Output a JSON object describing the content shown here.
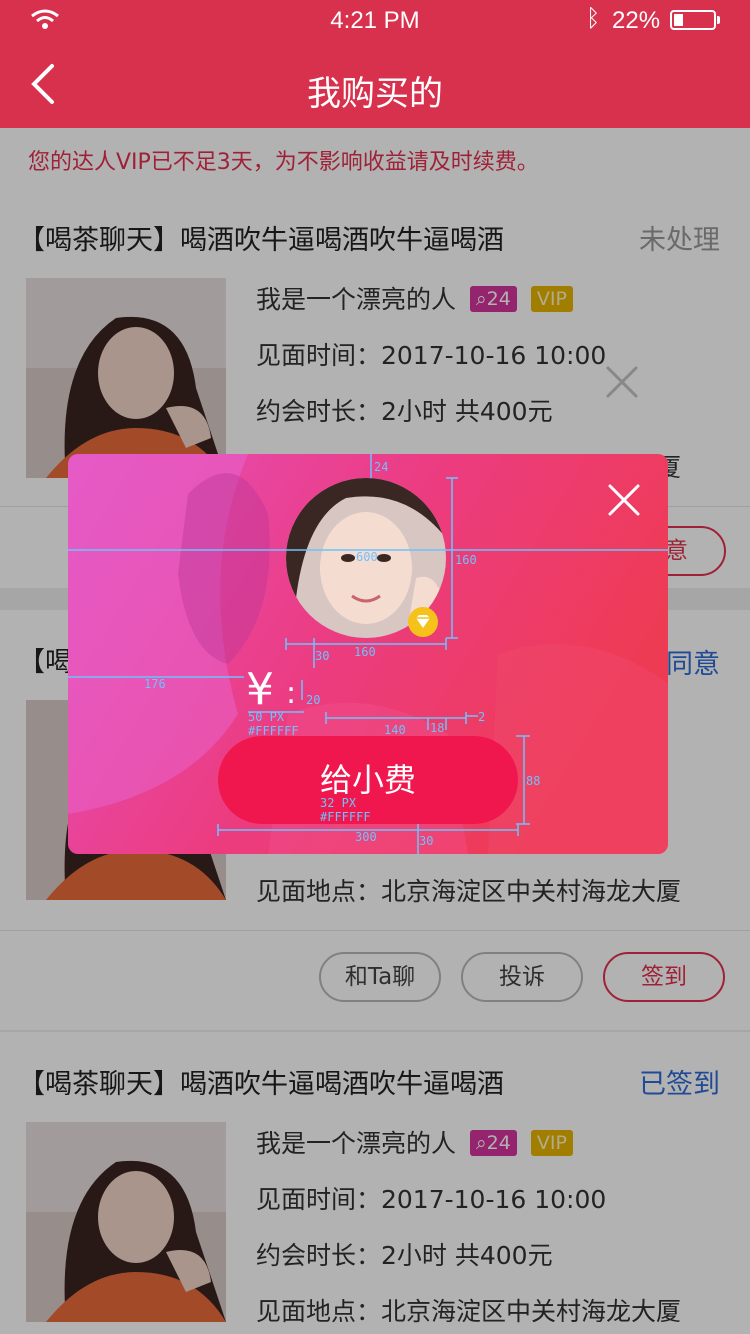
{
  "status_bar": {
    "time": "4:21 PM",
    "battery_pct": "22%",
    "icons": [
      "wifi-icon",
      "bluetooth-icon",
      "battery-icon"
    ]
  },
  "nav": {
    "title": "我购买的",
    "back_icon": "chevron-left-icon"
  },
  "notice": "您的达人VIP已不足3天，为不影响收益请及时续费。",
  "orders": [
    {
      "title": "【喝茶聊天】喝酒吹牛逼喝酒吹牛逼喝酒",
      "status": "未处理",
      "name": "我是一个漂亮的人",
      "badge_count": "24",
      "vip": "VIP",
      "time": "见面时间：2017-10-16  10:00",
      "duration": "约会时长：2小时  共400元",
      "place": "见面地点：北京海淀区中关村海龙大厦",
      "action": "意"
    },
    {
      "title": "【喝",
      "status": "同意",
      "place": "见面地点：北京海淀区中关村海龙大厦",
      "buttons": [
        "和Ta聊",
        "投诉",
        "签到"
      ]
    },
    {
      "title": "【喝茶聊天】喝酒吹牛逼喝酒吹牛逼喝酒",
      "status": "已签到",
      "name": "我是一个漂亮的人",
      "badge_count": "24",
      "vip": "VIP",
      "time": "见面时间：2017-10-16  10:00",
      "duration": "约会时长：2小时  共400元",
      "place": "见面地点：北京海淀区中关村海龙大厦"
    }
  ],
  "modal": {
    "currency": "¥",
    "amount": ":",
    "button": "给小费"
  },
  "spec_annotations": {
    "top_gap": "24",
    "width": "600",
    "avatar_h": "160",
    "avatar_w": "160",
    "gap_30": "30",
    "left_176": "176",
    "gap_20": "20",
    "font_50": "50 PX",
    "color_1": "#FFFFFF",
    "line_140": "140",
    "line_18": "18",
    "line_2": "2",
    "btn_h": "88",
    "font_32": "32 PX",
    "color_2": "#FFFFFF",
    "btn_w": "300",
    "bottom_30": "30"
  },
  "colors": {
    "brand": "#d8314d",
    "accent": "#f0174e",
    "link": "#2e6bd6",
    "vip": "#e7b400",
    "badge": "#d4349c",
    "annotation": "#6ec2ff"
  }
}
